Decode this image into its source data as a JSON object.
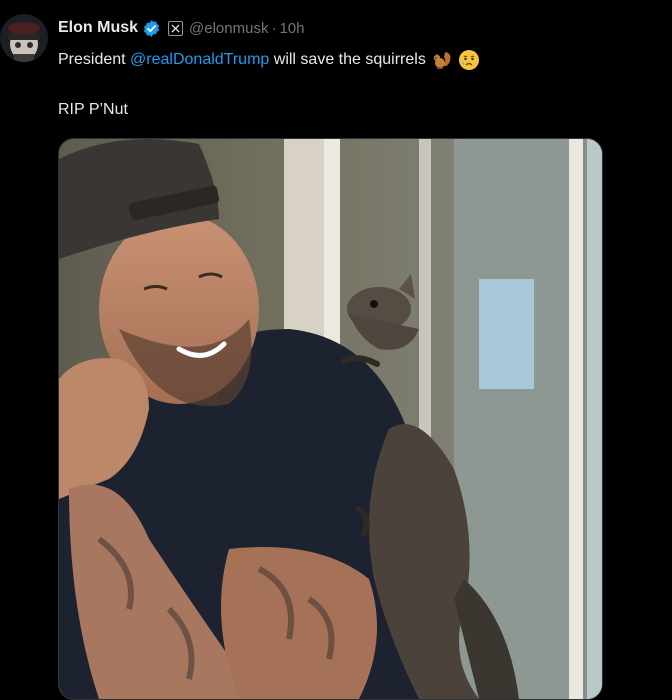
{
  "tweet": {
    "author": {
      "display_name": "Elon Musk",
      "handle": "@elonmusk",
      "verified_icon": "verified-badge-icon",
      "affiliation_icon": "x-logo-icon"
    },
    "separator": "·",
    "time": "10h",
    "text_before_mention": "President ",
    "mention": "@realDonaldTrump",
    "text_after_mention": " will save the squirrels",
    "emojis": [
      "squirrel-emoji-icon",
      "crying-face-emoji-icon"
    ],
    "second_line": "RIP P’Nut"
  },
  "colors": {
    "background": "#000000",
    "text": "#e7e9ea",
    "muted": "#71767b",
    "link": "#1d9bf0",
    "verified": "#1d9bf0"
  }
}
